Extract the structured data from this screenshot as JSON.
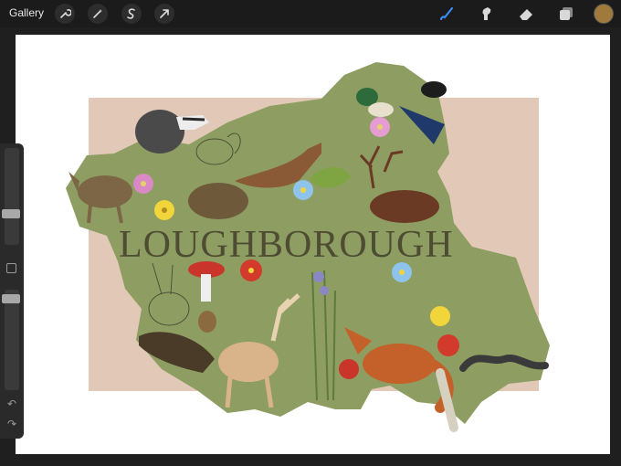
{
  "toolbar": {
    "gallery_label": "Gallery",
    "left_icons": [
      "wrench-icon",
      "magic-wand-icon",
      "selection-icon",
      "transform-arrow-icon"
    ],
    "right_icons": [
      "brush-icon",
      "smudge-icon",
      "eraser-icon",
      "layers-icon"
    ],
    "active_tool": "brush",
    "current_color": "#a07a3c"
  },
  "sidebar": {
    "brush_size_level": 0.3,
    "opacity_level": 0.95,
    "modify_button_icon": "square-icon",
    "undo_icon": "undo-icon",
    "redo_icon": "redo-icon"
  },
  "canvas": {
    "background": "#ffffff",
    "rectangle_color": "#e2c8b7",
    "map_color": "#8e9e62",
    "title_text": "LOUGHBOROUGH"
  }
}
